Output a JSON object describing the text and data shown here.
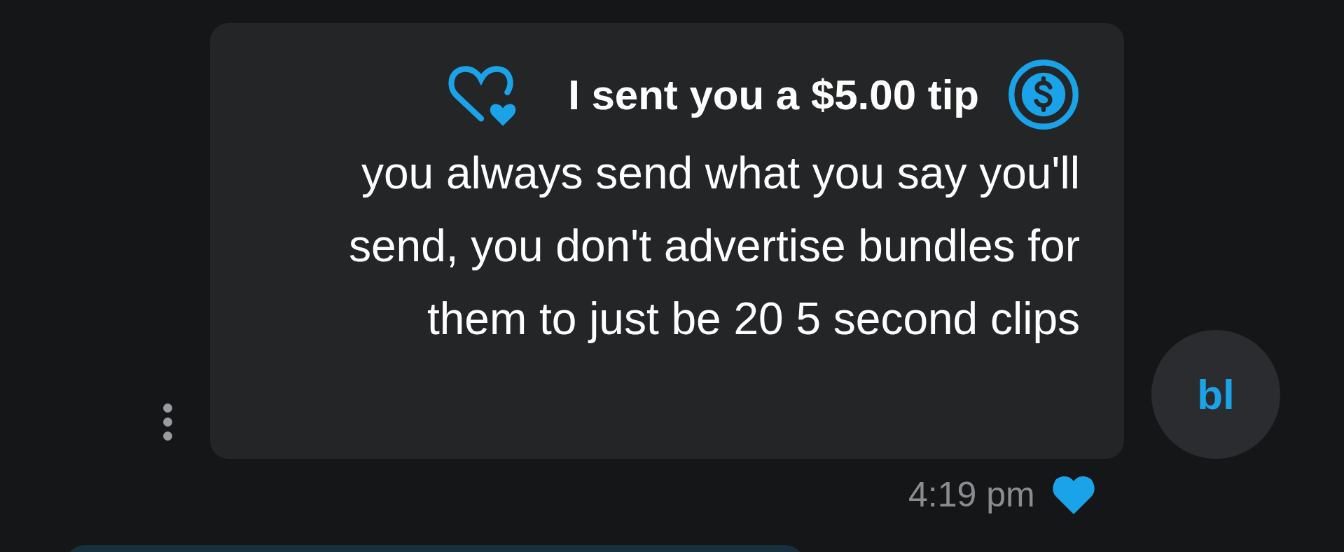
{
  "message": {
    "tip": "I sent you a $5.00 tip",
    "body": "you always send what you say you'll send, you don't advertise bundles for them to just be 20 5 second clips",
    "time": "4:19 pm",
    "liked": true
  },
  "avatar": {
    "initials": "bl"
  }
}
